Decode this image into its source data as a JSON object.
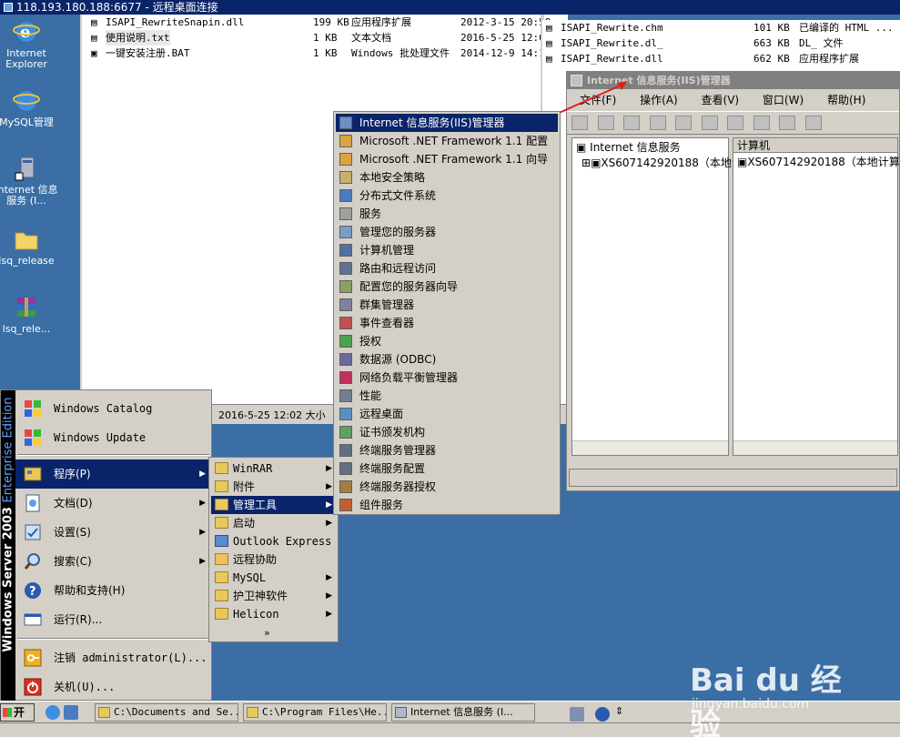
{
  "rdp_title": "118.193.180.188:6677 - 远程桌面连接",
  "desktop_icons": [
    {
      "label": "Internet Explorer"
    },
    {
      "label": "MySQL管理"
    },
    {
      "label": "Internet 信息服务 (I..."
    },
    {
      "label": "lsq_release"
    },
    {
      "label": "lsq_rele..."
    }
  ],
  "explorer": {
    "files": [
      {
        "name": "ISAPI_RewriteSnapin.dll",
        "size": "199 KB",
        "type": "应用程序扩展",
        "date": "2012-3-15 20:59"
      },
      {
        "name": "使用说明.txt",
        "size": "1 KB",
        "type": "文本文档",
        "date": "2016-5-25 12:02"
      },
      {
        "name": "一键安装注册.BAT",
        "size": "1 KB",
        "type": "Windows 批处理文件",
        "date": "2014-12-9 14:18"
      }
    ],
    "status": "2016-5-25 12:02 大小"
  },
  "right_files": [
    {
      "name": "ISAPI_Rewrite.chm",
      "size": "101 KB",
      "type": "已编译的 HTML ..."
    },
    {
      "name": "ISAPI_Rewrite.dl_",
      "size": "663 KB",
      "type": "DL_ 文件"
    },
    {
      "name": "ISAPI_Rewrite.dll",
      "size": "662 KB",
      "type": "应用程序扩展"
    }
  ],
  "iis": {
    "title": "Internet 信息服务(IIS)管理器",
    "menu": [
      "文件(F)",
      "操作(A)",
      "查看(V)",
      "窗口(W)",
      "帮助(H)"
    ],
    "tree_root": "Internet 信息服务",
    "tree_node": "XS607142920188（本地计",
    "col_header": "计算机",
    "right_item": "XS607142920188（本地计算机）"
  },
  "start_menu": {
    "side_text": "Windows Server 2003",
    "side_edition": "Enterprise Edition",
    "top_items": [
      {
        "label": "Windows Catalog"
      },
      {
        "label": "Windows Update"
      }
    ],
    "items": [
      {
        "label": "程序(P)",
        "submenu": true
      },
      {
        "label": "文档(D)",
        "submenu": true
      },
      {
        "label": "设置(S)",
        "submenu": true
      },
      {
        "label": "搜索(C)",
        "submenu": true
      },
      {
        "label": "帮助和支持(H)",
        "submenu": false
      },
      {
        "label": "运行(R)...",
        "submenu": false
      }
    ],
    "bottom_items": [
      {
        "label": "注销 administrator(L)..."
      },
      {
        "label": "关机(U)..."
      }
    ]
  },
  "programs_menu": [
    {
      "label": "WinRAR",
      "submenu": true
    },
    {
      "label": "附件",
      "submenu": true
    },
    {
      "label": "管理工具",
      "submenu": true,
      "selected": true
    },
    {
      "label": "启动",
      "submenu": true
    },
    {
      "label": "Outlook Express",
      "submenu": false
    },
    {
      "label": "远程协助",
      "submenu": false
    },
    {
      "label": "MySQL",
      "submenu": true
    },
    {
      "label": "护卫神软件",
      "submenu": true
    },
    {
      "label": "Helicon",
      "submenu": true
    }
  ],
  "programs_more": "»",
  "admin_tools_menu": [
    {
      "label": "Internet 信息服务(IIS)管理器",
      "color": "#6b8fc7"
    },
    {
      "label": "Microsoft .NET Framework 1.1 配置",
      "color": "#d9a441"
    },
    {
      "label": "Microsoft .NET Framework 1.1 向导",
      "color": "#d9a441"
    },
    {
      "label": "本地安全策略",
      "color": "#c9b06a"
    },
    {
      "label": "分布式文件系统",
      "color": "#4a7bc0"
    },
    {
      "label": "服务",
      "color": "#a0a0a0"
    },
    {
      "label": "管理您的服务器",
      "color": "#7a9ac8"
    },
    {
      "label": "计算机管理",
      "color": "#5070a0"
    },
    {
      "label": "路由和远程访问",
      "color": "#607090"
    },
    {
      "label": "配置您的服务器向导",
      "color": "#88a060"
    },
    {
      "label": "群集管理器",
      "color": "#8080a0"
    },
    {
      "label": "事件查看器",
      "color": "#c05050"
    },
    {
      "label": "授权",
      "color": "#50a050"
    },
    {
      "label": "数据源 (ODBC)",
      "color": "#6a6aa0"
    },
    {
      "label": "网络负载平衡管理器",
      "color": "#c03060"
    },
    {
      "label": "性能",
      "color": "#708090"
    },
    {
      "label": "远程桌面",
      "color": "#5a90c0"
    },
    {
      "label": "证书颁发机构",
      "color": "#60a060"
    },
    {
      "label": "终端服务管理器",
      "color": "#607080"
    },
    {
      "label": "终端服务配置",
      "color": "#607080"
    },
    {
      "label": "终端服务器授权",
      "color": "#a08040"
    },
    {
      "label": "组件服务",
      "color": "#c06030"
    }
  ],
  "taskbar": {
    "start_label": "开始",
    "tasks": [
      {
        "label": "C:\\Documents and Se..."
      },
      {
        "label": "C:\\Program Files\\He..."
      },
      {
        "label": "Internet 信息服务 (I..."
      }
    ]
  },
  "watermark": {
    "brand": "Bai du 经验",
    "url": "jingyan.baidu.com"
  },
  "colors": {
    "selection": "#0a246a",
    "desktop": "#3a6ea5",
    "menu": "#d4d0c8"
  }
}
